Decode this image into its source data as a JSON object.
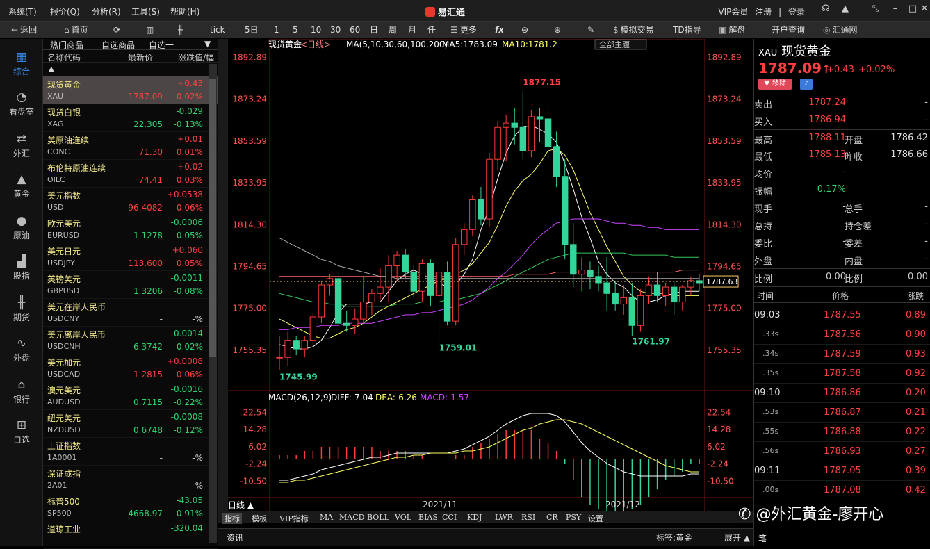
{
  "menu": [
    "系统(T)",
    "报价(Q)",
    "分析(R)",
    "工具(S)",
    "帮助(H)"
  ],
  "brand": "易汇通",
  "topright": [
    "VIP会员",
    "注册",
    "|",
    "登录"
  ],
  "toolbar": {
    "back": "返回",
    "home": "首页",
    "tick": "tick",
    "p5d": "5日",
    "p1": "1",
    "p5": "5",
    "p10": "10",
    "p30": "30",
    "p60": "60",
    "day": "日",
    "week": "周",
    "month": "月",
    "any": "任",
    "more": "更多",
    "sim": "模拟交易",
    "td": "TD指导",
    "jiepan": "解盘",
    "kaihu": "开户查询",
    "huitong": "汇通网"
  },
  "nav": [
    "综合",
    "看盘室",
    "外汇",
    "黄金",
    "原油",
    "股指",
    "期货",
    "外盘",
    "银行",
    "自选"
  ],
  "watchlist": {
    "tabs": [
      "热门商品",
      "自选商品",
      "自选一"
    ],
    "headers": [
      "名称代码",
      "最新价",
      "涨跌值/幅"
    ],
    "rows": [
      {
        "name": "现货黄金",
        "code": "XAU",
        "price": "1787.09",
        "chg": "+0.43",
        "pct": "0.02%",
        "dir": "up"
      },
      {
        "name": "现货白银",
        "code": "XAG",
        "price": "22.305",
        "chg": "-0.029",
        "pct": "-0.13%",
        "dir": "dn"
      },
      {
        "name": "美原油连续",
        "code": "CONC",
        "price": "71.30",
        "chg": "+0.01",
        "pct": "0.01%",
        "dir": "up"
      },
      {
        "name": "布伦特原油连续",
        "code": "OILC",
        "price": "74.41",
        "chg": "+0.02",
        "pct": "0.03%",
        "dir": "up"
      },
      {
        "name": "美元指数",
        "code": "USD",
        "price": "96.4082",
        "chg": "+0.0538",
        "pct": "0.06%",
        "dir": "up"
      },
      {
        "name": "欧元美元",
        "code": "EURUSD",
        "price": "1.1278",
        "chg": "-0.0006",
        "pct": "-0.05%",
        "dir": "dn"
      },
      {
        "name": "美元日元",
        "code": "USDJPY",
        "price": "113.600",
        "chg": "+0.060",
        "pct": "0.05%",
        "dir": "up"
      },
      {
        "name": "英镑美元",
        "code": "GBPUSD",
        "price": "1.3206",
        "chg": "-0.0011",
        "pct": "-0.08%",
        "dir": "dn"
      },
      {
        "name": "美元在岸人民币",
        "code": "USDCNY",
        "price": "-",
        "chg": "-",
        "pct": "-%",
        "dir": "dn"
      },
      {
        "name": "美元离岸人民币",
        "code": "USDCNH",
        "price": "6.3742",
        "chg": "-0.0014",
        "pct": "-0.02%",
        "dir": "dn"
      },
      {
        "name": "美元加元",
        "code": "USDCAD",
        "price": "1.2815",
        "chg": "+0.0008",
        "pct": "0.06%",
        "dir": "up"
      },
      {
        "name": "澳元美元",
        "code": "AUDUSD",
        "price": "0.7115",
        "chg": "-0.0016",
        "pct": "-0.22%",
        "dir": "dn"
      },
      {
        "name": "纽元美元",
        "code": "NZDUSD",
        "price": "0.6748",
        "chg": "-0.0008",
        "pct": "-0.12%",
        "dir": "dn"
      },
      {
        "name": "上证指数",
        "code": "1A0001",
        "price": "-",
        "chg": "-",
        "pct": "-%",
        "dir": "dn"
      },
      {
        "name": "深证成指",
        "code": "2A01",
        "price": "-",
        "chg": "-",
        "pct": "-%",
        "dir": "dn"
      },
      {
        "name": "标普500",
        "code": "SP500",
        "price": "4668.97",
        "chg": "-43.05",
        "pct": "-0.91%",
        "dir": "dn"
      },
      {
        "name": "道琼工业",
        "code": "",
        "price": "",
        "chg": "-320.04",
        "pct": "",
        "dir": "dn"
      }
    ]
  },
  "chart": {
    "title": "现货黄金",
    "period": "<日线>",
    "ma_label": "MA(5,10,30,60,100,200)",
    "ma5": "MA5:1783.09",
    "ma10": "MA10:1781.2",
    "theme_btn": "全部主题",
    "yticks": [
      "1892.89",
      "1873.24",
      "1853.59",
      "1833.95",
      "1814.30",
      "1794.65",
      "1775.00",
      "1755.35"
    ],
    "last_price": "1787.63",
    "annotations": [
      "1877.15",
      "1759.01",
      "1761.97",
      "1745.99"
    ],
    "macd_label": "MACD(26,12,9)",
    "diff": "DIFF:-7.04",
    "dea": "DEA:-6.26",
    "macd": "MACD:-1.57",
    "macd_ticks": [
      "22.54",
      "14.28",
      "6.02",
      "-2.24",
      "-10.50"
    ],
    "xlabels": [
      "2021/11",
      "2021/12"
    ],
    "period_btn": "日线 ▲"
  },
  "chart_data": {
    "type": "candlestick",
    "ohlc": [
      [
        1752,
        1762,
        1746,
        1752
      ],
      [
        1752,
        1764,
        1748,
        1760
      ],
      [
        1760,
        1762,
        1753,
        1756
      ],
      [
        1756,
        1762,
        1752,
        1760
      ],
      [
        1760,
        1773,
        1758,
        1771
      ],
      [
        1771,
        1788,
        1768,
        1786
      ],
      [
        1786,
        1791,
        1781,
        1789
      ],
      [
        1789,
        1792,
        1766,
        1768
      ],
      [
        1768,
        1774,
        1764,
        1767
      ],
      [
        1767,
        1775,
        1763,
        1770
      ],
      [
        1770,
        1790,
        1768,
        1778
      ],
      [
        1778,
        1784,
        1772,
        1782
      ],
      [
        1782,
        1794,
        1779,
        1785
      ],
      [
        1785,
        1800,
        1778,
        1795
      ],
      [
        1795,
        1802,
        1788,
        1800
      ],
      [
        1800,
        1803,
        1789,
        1792
      ],
      [
        1792,
        1795,
        1780,
        1783
      ],
      [
        1783,
        1798,
        1778,
        1796
      ],
      [
        1796,
        1798,
        1776,
        1781
      ],
      [
        1781,
        1792,
        1759,
        1792
      ],
      [
        1792,
        1797,
        1767,
        1769
      ],
      [
        1769,
        1808,
        1767,
        1805
      ],
      [
        1805,
        1815,
        1800,
        1812
      ],
      [
        1812,
        1828,
        1809,
        1826
      ],
      [
        1826,
        1832,
        1814,
        1817
      ],
      [
        1817,
        1848,
        1813,
        1845
      ],
      [
        1845,
        1863,
        1840,
        1860
      ],
      [
        1860,
        1866,
        1844,
        1862
      ],
      [
        1862,
        1869,
        1852,
        1860
      ],
      [
        1860,
        1877,
        1845,
        1849
      ],
      [
        1849,
        1868,
        1846,
        1865
      ],
      [
        1865,
        1869,
        1853,
        1864
      ],
      [
        1864,
        1870,
        1846,
        1851
      ],
      [
        1851,
        1858,
        1832,
        1837
      ],
      [
        1837,
        1845,
        1798,
        1805
      ],
      [
        1805,
        1815,
        1785,
        1791
      ],
      [
        1791,
        1799,
        1783,
        1793
      ],
      [
        1793,
        1797,
        1784,
        1790
      ],
      [
        1790,
        1795,
        1783,
        1787
      ],
      [
        1787,
        1799,
        1774,
        1782
      ],
      [
        1782,
        1788,
        1774,
        1777
      ],
      [
        1777,
        1786,
        1772,
        1780
      ],
      [
        1780,
        1787,
        1762,
        1767
      ],
      [
        1767,
        1784,
        1764,
        1781
      ],
      [
        1781,
        1790,
        1777,
        1786
      ],
      [
        1786,
        1792,
        1778,
        1781
      ],
      [
        1781,
        1787,
        1776,
        1785
      ],
      [
        1785,
        1788,
        1772,
        1778
      ],
      [
        1778,
        1786,
        1774,
        1785
      ],
      [
        1785,
        1790,
        1781,
        1788
      ],
      [
        1788,
        1791,
        1783,
        1787
      ]
    ],
    "ma": [
      {
        "name": "MA5",
        "color": "#ffffff",
        "values": [
          1758,
          1757,
          1756,
          1756,
          1757,
          1760,
          1766,
          1773,
          1777,
          1777,
          1777,
          1778,
          1778,
          1783,
          1788,
          1791,
          1793,
          1791,
          1789,
          1787,
          1785,
          1786,
          1791,
          1798,
          1812,
          1822,
          1836,
          1848,
          1856,
          1860,
          1861,
          1859,
          1857,
          1853,
          1843,
          1831,
          1818,
          1808,
          1797,
          1791,
          1787,
          1785,
          1781,
          1778,
          1778,
          1779,
          1781,
          1782,
          1783,
          1783,
          1783
        ]
      },
      {
        "name": "MA10",
        "color": "#ffff66",
        "values": [
          1770,
          1768,
          1766,
          1764,
          1762,
          1761,
          1761,
          1763,
          1765,
          1766,
          1768,
          1771,
          1774,
          1776,
          1778,
          1780,
          1782,
          1784,
          1786,
          1788,
          1789,
          1791,
          1793,
          1796,
          1801,
          1806,
          1814,
          1823,
          1830,
          1835,
          1838,
          1843,
          1849,
          1850,
          1847,
          1840,
          1830,
          1820,
          1812,
          1804,
          1797,
          1790,
          1786,
          1783,
          1782,
          1782,
          1782,
          1781,
          1781,
          1781,
          1781
        ]
      },
      {
        "name": "MA30",
        "color": "#34c759",
        "values": [
          1782,
          1781,
          1780,
          1779,
          1778,
          1778,
          1777,
          1777,
          1776,
          1776,
          1776,
          1776,
          1776,
          1776,
          1777,
          1777,
          1777,
          1778,
          1778,
          1778,
          1779,
          1779,
          1780,
          1781,
          1782,
          1784,
          1786,
          1788,
          1790,
          1792,
          1794,
          1796,
          1798,
          1799,
          1800,
          1801,
          1801,
          1801,
          1801,
          1801,
          1801,
          1801,
          1800,
          1800,
          1800,
          1800,
          1800,
          1799,
          1799,
          1799,
          1799
        ]
      },
      {
        "name": "MA60",
        "color": "#cc44ff",
        "values": [
          1765,
          1765,
          1766,
          1766,
          1766,
          1767,
          1767,
          1767,
          1768,
          1768,
          1768,
          1768,
          1769,
          1770,
          1771,
          1772,
          1772,
          1773,
          1773,
          1774,
          1775,
          1776,
          1777,
          1779,
          1782,
          1785,
          1789,
          1792,
          1796,
          1800,
          1805,
          1809,
          1812,
          1815,
          1816,
          1817,
          1817,
          1817,
          1817,
          1816,
          1815,
          1815,
          1814,
          1814,
          1813,
          1813,
          1812,
          1812,
          1812,
          1812,
          1812
        ]
      },
      {
        "name": "MA100",
        "color": "#ff6060",
        "values": [
          1790,
          1790,
          1790,
          1790,
          1790,
          1790,
          1790,
          1790,
          1790,
          1790,
          1790,
          1790,
          1790,
          1790,
          1790,
          1790,
          1790,
          1790,
          1790,
          1790,
          1790,
          1790,
          1790,
          1790,
          1790,
          1790,
          1790,
          1790,
          1791,
          1791,
          1791,
          1791,
          1791,
          1792,
          1792,
          1792,
          1792,
          1792,
          1792,
          1792,
          1792,
          1792,
          1792,
          1792,
          1792,
          1792,
          1792,
          1792,
          1793,
          1793,
          1793
        ]
      },
      {
        "name": "MA200",
        "color": "#aaaaaa",
        "values": [
          1808,
          1806,
          1804,
          1802,
          1800,
          1798,
          1797,
          1795,
          1794,
          1793,
          1792,
          1791,
          1790,
          1790,
          1789,
          1789,
          1789,
          1789,
          1789,
          1789,
          1789,
          1789,
          1789,
          1789,
          1789,
          1789,
          1789,
          1789,
          1789,
          1789,
          1789,
          1789,
          1789,
          1789,
          1789,
          1789,
          1789,
          1789,
          1789,
          1789,
          1789,
          1789,
          1789,
          1789,
          1789,
          1789,
          1789,
          1789,
          1789,
          1789,
          1789
        ]
      }
    ],
    "macd": {
      "diff": [
        -10,
        -10,
        -9,
        -8,
        -7,
        -5,
        -4,
        -3,
        -2,
        -1,
        0,
        1,
        1,
        2,
        3,
        3,
        3,
        3,
        3,
        3,
        3,
        4,
        5,
        7,
        9,
        11,
        14,
        17,
        19,
        21,
        22,
        22,
        22,
        21,
        18,
        13,
        8,
        4,
        1,
        -2,
        -4,
        -6,
        -7,
        -8,
        -8,
        -8,
        -8,
        -8,
        -8,
        -7,
        -7
      ],
      "dea": [
        -11,
        -11,
        -10,
        -10,
        -9,
        -8,
        -7,
        -6,
        -5,
        -4,
        -3,
        -2,
        -1,
        0,
        1,
        1,
        2,
        2,
        3,
        3,
        3,
        3,
        4,
        4,
        5,
        6,
        8,
        10,
        12,
        14,
        15,
        17,
        18,
        19,
        19,
        18,
        17,
        15,
        13,
        11,
        9,
        7,
        5,
        3,
        1,
        -1,
        -3,
        -4,
        -5,
        -6,
        -6
      ]
    },
    "ylim": [
      1740,
      1895
    ],
    "macd_ylim": [
      -15,
      25
    ]
  },
  "quote": {
    "symbol": "XAU",
    "name": "现货黄金",
    "price": "1787.09",
    "arrow": "↑",
    "chg": "+0.43",
    "pct": "+0.02%",
    "remove": "移除",
    "rows": [
      {
        "l": "卖出",
        "v": "1787.24",
        "l2": "",
        "v2": "-"
      },
      {
        "l": "买入",
        "v": "1786.94",
        "l2": "",
        "v2": "-"
      },
      {
        "l": "最高",
        "v": "1788.11",
        "l2": "开盘",
        "v2": "1786.42"
      },
      {
        "l": "最低",
        "v": "1785.13",
        "l2": "昨收",
        "v2": "1786.66"
      },
      {
        "l": "均价",
        "v": "-",
        "l2": "",
        "v2": ""
      },
      {
        "l": "振幅",
        "v": "0.17%",
        "l2": "",
        "v2": ""
      },
      {
        "l": "现手",
        "v": "-",
        "l2": "总手",
        "v2": "-"
      },
      {
        "l": "总持",
        "v": "-",
        "l2": "持仓差",
        "v2": "-"
      },
      {
        "l": "委比",
        "v": "-",
        "l2": "委差",
        "v2": "-"
      },
      {
        "l": "外盘",
        "v": "-",
        "l2": "内盘",
        "v2": "-"
      },
      {
        "l": "比例",
        "v": "0.00",
        "l2": "比例",
        "v2": "0.00"
      }
    ],
    "tick_headers": [
      "时间",
      "价格",
      "涨跌"
    ],
    "ticks": [
      {
        "t": "09:03",
        "p": "1787.55",
        "c": "0.89"
      },
      {
        "t": ".33s",
        "p": "1787.56",
        "c": "0.90"
      },
      {
        "t": ".34s",
        "p": "1787.59",
        "c": "0.93"
      },
      {
        "t": ".35s",
        "p": "1787.58",
        "c": "0.92"
      },
      {
        "t": "09:10",
        "p": "1786.86",
        "c": "0.20"
      },
      {
        "t": ".53s",
        "p": "1786.87",
        "c": "0.21"
      },
      {
        "t": ".55s",
        "p": "1786.88",
        "c": "0.22"
      },
      {
        "t": ".56s",
        "p": "1786.93",
        "c": "0.27"
      },
      {
        "t": "09:11",
        "p": "1787.05",
        "c": "0.39"
      },
      {
        "t": ".00s",
        "p": "1787.08",
        "c": "0.42"
      }
    ]
  },
  "bottom_tabs": [
    "指标",
    "模板",
    "VIP指标",
    "MA",
    "MACD",
    "BOLL",
    "VOL",
    "BIAS",
    "CCI",
    "KDJ",
    "LWR",
    "RSI",
    "CR",
    "PSY",
    "设置"
  ],
  "info": {
    "tab": "资讯",
    "tag": "标签:黄金",
    "expand": "展开 ▲",
    "note": "笔"
  },
  "watermark": "@外汇黄金-廖开心"
}
